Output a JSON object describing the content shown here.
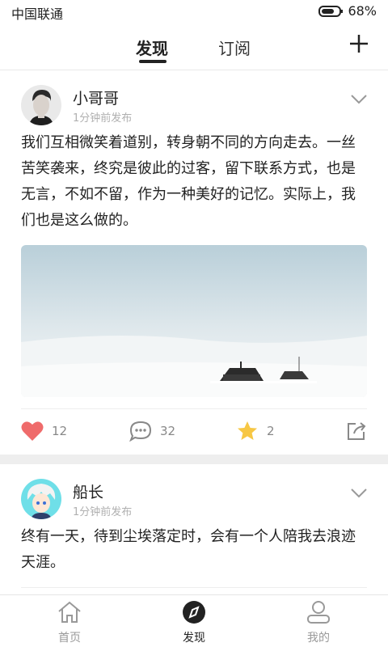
{
  "status_bar": {
    "carrier": "中国联通",
    "battery": "68%"
  },
  "top_nav": {
    "tabs": [
      "发现",
      "订阅"
    ],
    "active_tab": "发现"
  },
  "posts": [
    {
      "author": "小哥哥",
      "time": "1分钟前发布",
      "text": "我们互相微笑着道别，转身朝不同的方向走去。一丝苦笑袭来，终究是彼此的过客，留下联系方式，也是无言，不如不留，作为一种美好的记忆。实际上，我们也是这么做的。",
      "likes": "12",
      "comments": "32",
      "stars": "2"
    },
    {
      "author": "船长",
      "time": "1分钟前发布",
      "text": "终有一天，待到尘埃落定时，会有一个人陪我去浪迹天涯。"
    }
  ],
  "bottom_nav": {
    "items": [
      "首页",
      "发现",
      "我的"
    ],
    "active": "发现"
  },
  "colors": {
    "like_red": "#ef6b6b",
    "star_yellow": "#f7c744",
    "icon_gray": "#999999",
    "text": "#222222"
  }
}
